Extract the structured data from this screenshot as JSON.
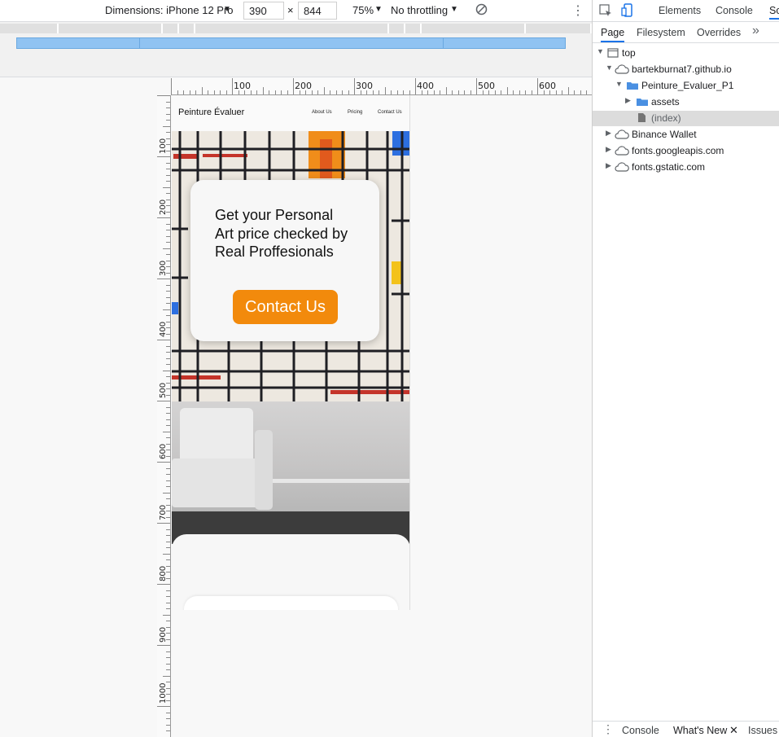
{
  "toolbar": {
    "dimensions_label": "Dimensions: iPhone 12 Pro",
    "width": "390",
    "times": "×",
    "height": "844",
    "zoom": "75%",
    "throttling": "No throttling"
  },
  "ruler": {
    "h": [
      "100",
      "200",
      "300",
      "400",
      "500",
      "600"
    ],
    "v": [
      "100",
      "200",
      "300",
      "400",
      "500",
      "600",
      "700",
      "800",
      "900",
      "1000"
    ]
  },
  "site": {
    "brand": "Peinture Évaluer",
    "nav": [
      "About Us",
      "Pricing",
      "Contact Us"
    ],
    "headline": "Get your Personal Art price checked by Real Proffesionals",
    "cta": "Contact Us"
  },
  "devtools": {
    "tabs": [
      "Elements",
      "Console",
      "So"
    ],
    "subtabs": [
      "Page",
      "Filesystem",
      "Overrides"
    ],
    "tree": {
      "top": "top",
      "domain": "bartekburnat7.github.io",
      "folder": "Peinture_Evaluer_P1",
      "assets": "assets",
      "index": "(index)",
      "others": [
        "Binance Wallet",
        "fonts.googleapis.com",
        "fonts.gstatic.com"
      ]
    },
    "drawer": [
      "Console",
      "What's New",
      "Issues"
    ]
  },
  "colors": {
    "accent": "#f28a0c",
    "selection": "#dcdcdc",
    "folder": "#4a90e2",
    "bar": "#90c3f2"
  }
}
